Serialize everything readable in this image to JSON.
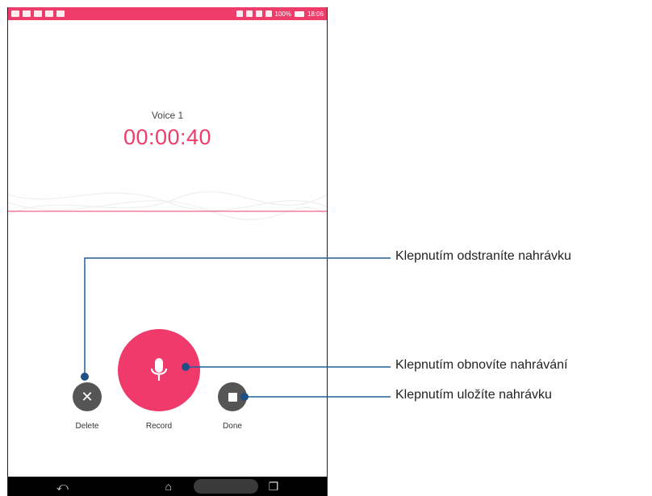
{
  "app": {
    "recording_name": "Voice 1",
    "timer": "00:00:40"
  },
  "status_bar": {
    "battery": "100%",
    "time": "18:06"
  },
  "controls": {
    "delete_label": "Delete",
    "record_label": "Record",
    "done_label": "Done"
  },
  "callouts": {
    "delete": "Klepnutím odstraníte nahrávku",
    "record": "Klepnutím obnovíte nahrávání",
    "done": "Klepnutím uložíte nahrávku"
  },
  "colors": {
    "accent": "#ee3d6b",
    "dark_button": "#555555",
    "callout_line": "#1f5f9e"
  },
  "icons": {
    "delete": "close-icon",
    "record": "microphone-icon",
    "done": "stop-icon",
    "nav_back": "back-icon",
    "nav_home": "home-icon",
    "nav_recent": "recent-apps-icon"
  }
}
